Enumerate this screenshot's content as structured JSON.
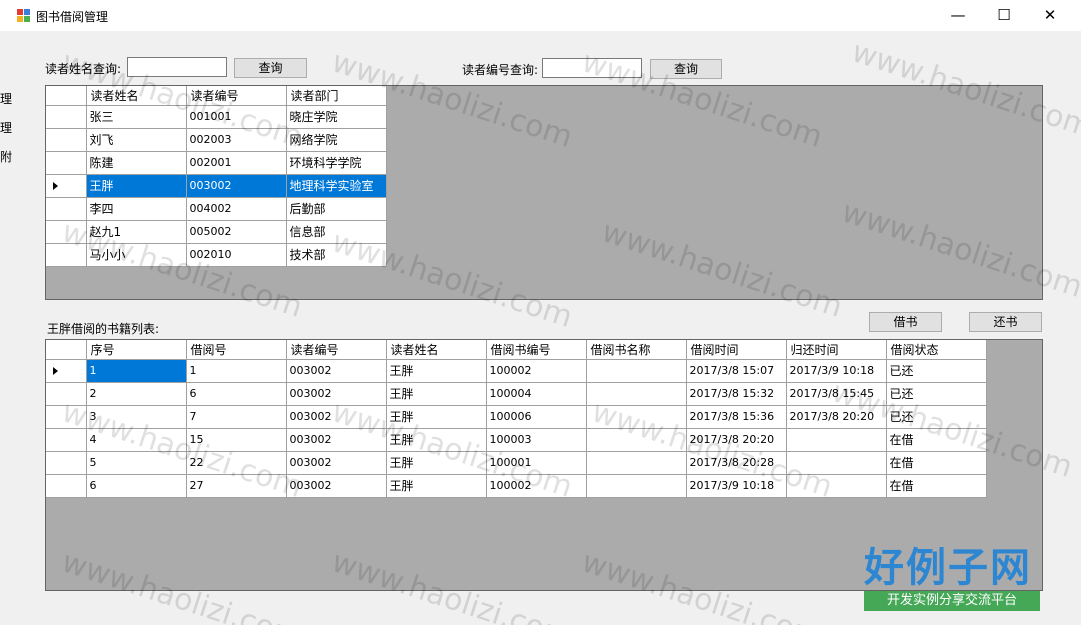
{
  "window": {
    "title": "图书借阅管理",
    "min_glyph": "—",
    "max_glyph": "☐",
    "close_glyph": "✕"
  },
  "left_strip": [
    "理",
    "理",
    "附"
  ],
  "search": {
    "name_label": "读者姓名查询:",
    "name_value": "",
    "name_button": "查询",
    "id_label": "读者编号查询:",
    "id_value": "",
    "id_button": "查询"
  },
  "readers": {
    "columns": [
      "读者姓名",
      "读者编号",
      "读者部门"
    ],
    "rows": [
      [
        "张三",
        "001001",
        "晓庄学院"
      ],
      [
        "刘飞",
        "002003",
        "网络学院"
      ],
      [
        "陈建",
        "002001",
        "环境科学学院"
      ],
      [
        "王胖",
        "003002",
        "地理科学实验室"
      ],
      [
        "李四",
        "004002",
        "后勤部"
      ],
      [
        "赵九1",
        "005002",
        "信息部"
      ],
      [
        "马小小",
        "002010",
        "技术部"
      ]
    ]
  },
  "books": {
    "caption": "王胖借阅的书籍列表:",
    "borrow_button": "借书",
    "return_button": "还书",
    "columns": [
      "序号",
      "借阅号",
      "读者编号",
      "读者姓名",
      "借阅书编号",
      "借阅书名称",
      "借阅时间",
      "归还时间",
      "借阅状态"
    ],
    "rows": [
      [
        "1",
        "1",
        "003002",
        "王胖",
        "100002",
        "",
        "2017/3/8 15:07",
        "2017/3/9 10:18",
        "已还"
      ],
      [
        "2",
        "6",
        "003002",
        "王胖",
        "100004",
        "",
        "2017/3/8 15:32",
        "2017/3/8 15:45",
        "已还"
      ],
      [
        "3",
        "7",
        "003002",
        "王胖",
        "100006",
        "",
        "2017/3/8 15:36",
        "2017/3/8 20:20",
        "已还"
      ],
      [
        "4",
        "15",
        "003002",
        "王胖",
        "100003",
        "",
        "2017/3/8 20:20",
        "",
        "在借"
      ],
      [
        "5",
        "22",
        "003002",
        "王胖",
        "100001",
        "",
        "2017/3/8 20:28",
        "",
        "在借"
      ],
      [
        "6",
        "27",
        "003002",
        "王胖",
        "100002",
        "",
        "2017/3/9 10:18",
        "",
        "在借"
      ]
    ]
  },
  "watermark": {
    "text": "www.haolizi.com",
    "logo_main": "好例子网",
    "logo_sub": "开发实例分享交流平台"
  }
}
